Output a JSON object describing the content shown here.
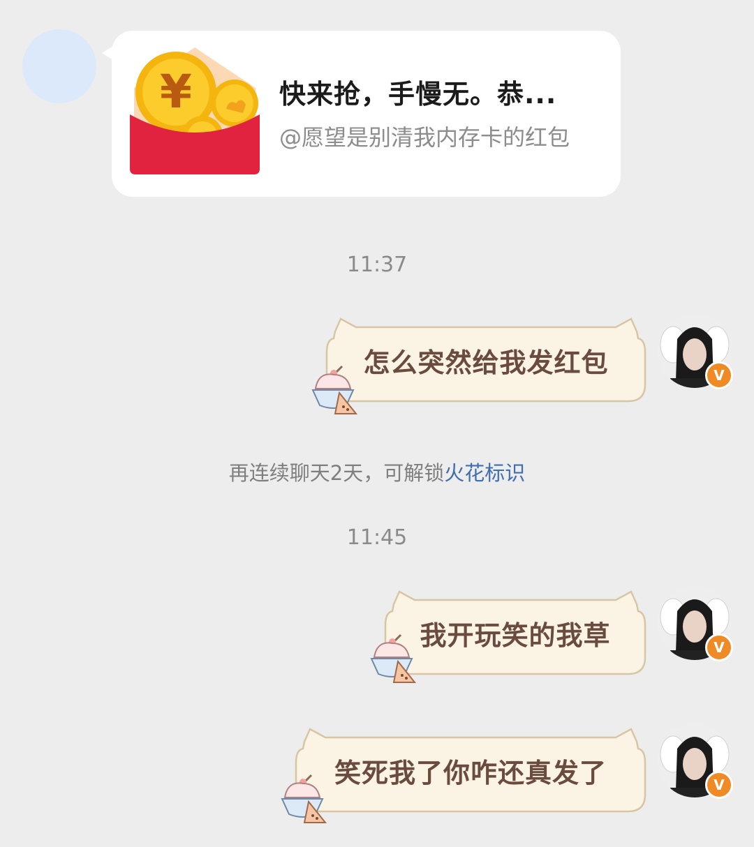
{
  "red_packet": {
    "title": "快来抢，手慢无。恭...",
    "sender": "@愿望是别清我内存卡的红包",
    "icon": "red-envelope-coin-icon"
  },
  "timestamps": [
    "11:37",
    "11:45"
  ],
  "system_tip": {
    "text": "再连续聊天2天，可解锁",
    "link": "火花标识"
  },
  "messages": [
    {
      "text": "怎么突然给我发红包"
    },
    {
      "text": "我开玩笑的我草"
    },
    {
      "text": "笑死我了你咋还真发了"
    }
  ],
  "badge": {
    "label": "V"
  },
  "colors": {
    "background": "#ededed",
    "bubble_fill": "#fbf4e4",
    "bubble_text": "#6a4b3f",
    "link": "#3f6fb0",
    "badge": "#f08a24",
    "envelope_red": "#e2233f",
    "coin_gold": "#f5b50f"
  }
}
